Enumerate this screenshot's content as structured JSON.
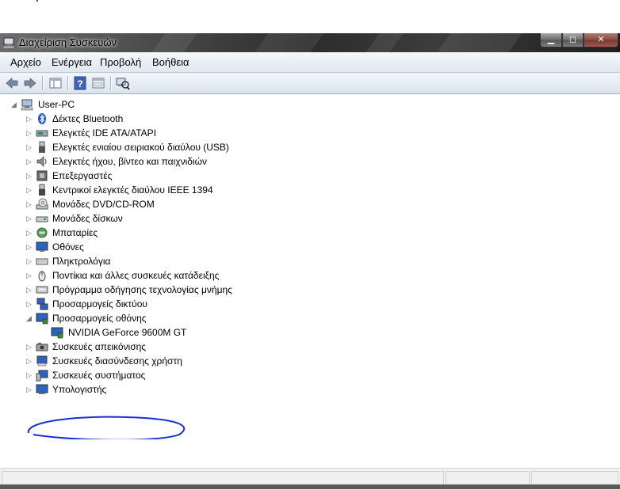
{
  "window": {
    "title": "Διαχείριση Συσκευών"
  },
  "menu": [
    "Αρχείο",
    "Ενέργεια",
    "Προβολή",
    "Βοήθεια"
  ],
  "tree": {
    "root": "User-PC",
    "categories": [
      {
        "label": "Δέκτες Bluetooth",
        "icon": "bluetooth-icon"
      },
      {
        "label": "Ελεγκτές IDE ATA/ATAPI",
        "icon": "ide-controller-icon"
      },
      {
        "label": "Ελεγκτές ενιαίου σειριακού διαύλου (USB)",
        "icon": "usb-icon"
      },
      {
        "label": "Ελεγκτές ήχου, βίντεο και παιχνιδιών",
        "icon": "sound-icon"
      },
      {
        "label": "Επεξεργαστές",
        "icon": "processor-icon"
      },
      {
        "label": "Κεντρικοί ελεγκτές διαύλου IEEE 1394",
        "icon": "firewire-icon"
      },
      {
        "label": "Μονάδες DVD/CD-ROM",
        "icon": "dvd-icon"
      },
      {
        "label": "Μονάδες δίσκων",
        "icon": "disk-icon"
      },
      {
        "label": "Μπαταρίες",
        "icon": "battery-icon"
      },
      {
        "label": "Οθόνες",
        "icon": "monitor-icon"
      },
      {
        "label": "Πληκτρολόγια",
        "icon": "keyboard-icon"
      },
      {
        "label": "Ποντίκια και άλλες συσκευές κατάδειξης",
        "icon": "mouse-icon"
      },
      {
        "label": "Πρόγραμμα οδήγησης τεχνολογίας μνήμης",
        "icon": "memory-icon"
      },
      {
        "label": "Προσαρμογείς δικτύου",
        "icon": "network-icon"
      },
      {
        "label": "Προσαρμογείς οθόνης",
        "icon": "display-adapter-icon",
        "expanded": true,
        "children": [
          {
            "label": "NVIDIA GeForce 9600M GT",
            "icon": "display-adapter-icon"
          }
        ]
      },
      {
        "label": "Συσκευές απεικόνισης",
        "icon": "imaging-icon"
      },
      {
        "label": "Συσκευές διασύνδεσης χρήστη",
        "icon": "hid-icon"
      },
      {
        "label": "Συσκευές συστήματος",
        "icon": "system-icon"
      },
      {
        "label": "Υπολογιστής",
        "icon": "computer-icon"
      }
    ]
  },
  "colors": {
    "annotation": "#1a2ed8",
    "titlebar": "#3a3a3a",
    "menubar": "#e6edf5"
  }
}
